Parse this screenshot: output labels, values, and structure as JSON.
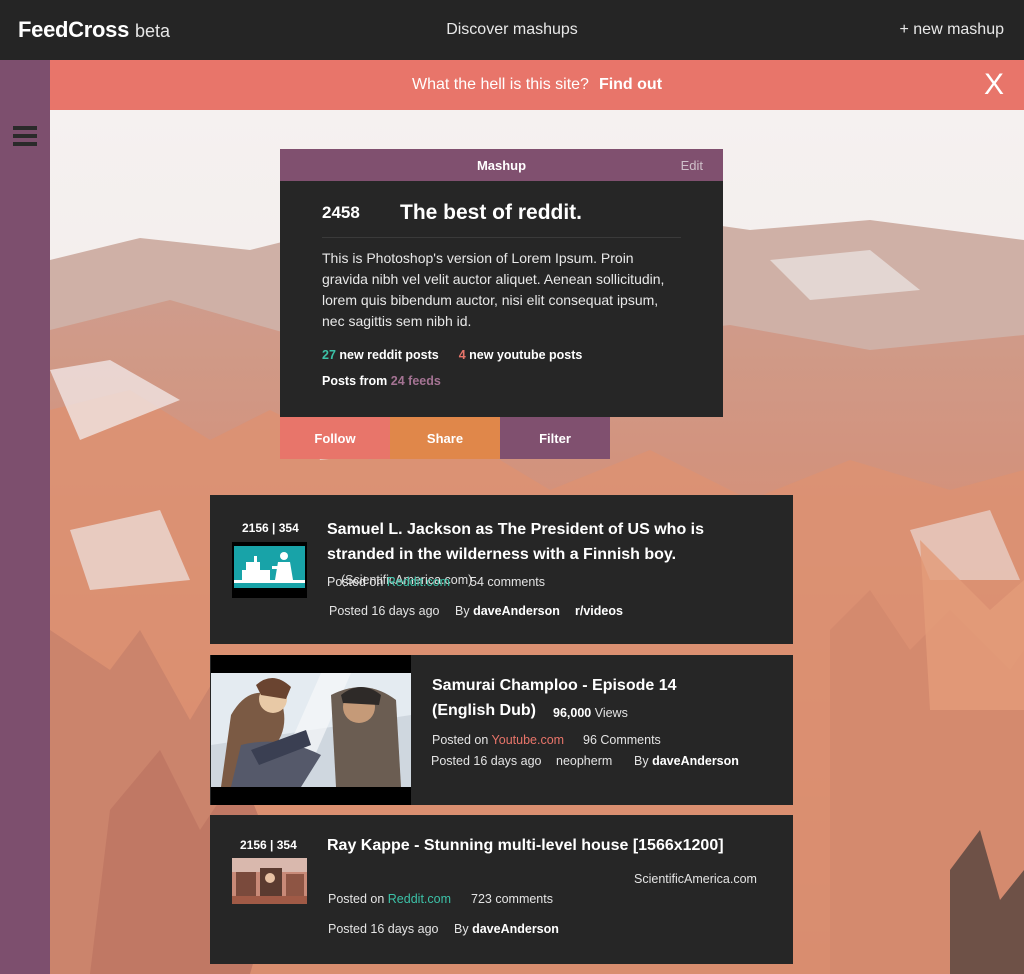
{
  "nav": {
    "brand": "FeedCross",
    "brand_tag": "beta",
    "center": "Discover mashups",
    "new_mashup": "+ new mashup"
  },
  "banner": {
    "question": "What the hell is this site?",
    "link": "Find out",
    "close": "X"
  },
  "mashup": {
    "header": "Mashup",
    "edit": "Edit",
    "score": "2458",
    "title": "The best of reddit.",
    "description": "This is Photoshop's version  of Lorem Ipsum. Proin gravida nibh vel velit auctor aliquet. Aenean sollicitudin, lorem quis bibendum auctor, nisi elit consequat ipsum, nec sagittis sem nibh id.",
    "reddit_count": "27",
    "reddit_label": "new reddit posts",
    "youtube_count": "4",
    "youtube_label": "new youtube posts",
    "feeds_prefix": "Posts from",
    "feeds_count": "24 feeds",
    "colors": {
      "plum": "#80506f",
      "coral": "#e8756a",
      "teal": "#3cc1a7",
      "orange": "#e0874a"
    }
  },
  "actions": {
    "follow": "Follow",
    "share": "Share",
    "filter": "Filter"
  },
  "posts": [
    {
      "votes": "2156 | 354",
      "title": "Samuel L. Jackson as The President of US who is stranded in the wilderness with a Finnish boy.",
      "source": "(ScientificAmerica.com)",
      "posted_on": "Posted on",
      "site": "Reddit.com",
      "comments": "54 comments",
      "age": "Posted 16 days ago",
      "by": "By",
      "author": "daveAnderson",
      "subreddit": "r/videos",
      "thumb_icon": "person-at-counter-icon"
    },
    {
      "title_line1": "Samurai Champloo - Episode 14",
      "title_line2": "(English Dub)",
      "views_count": "96,000",
      "views_label": "Views",
      "posted_on": "Posted on",
      "site": "Youtube.com",
      "comments": "96 Comments",
      "age": "Posted 16 days ago",
      "channel": "neopherm",
      "by": "By",
      "author": "daveAnderson"
    },
    {
      "votes": "2156 | 354",
      "title": "Ray Kappe - Stunning multi-level house [1566x1200]",
      "source": "ScientificAmerica.com",
      "posted_on": "Posted on",
      "site": "Reddit.com",
      "comments": "723 comments",
      "age": "Posted 16 days ago",
      "by": "By",
      "author": "daveAnderson"
    }
  ]
}
